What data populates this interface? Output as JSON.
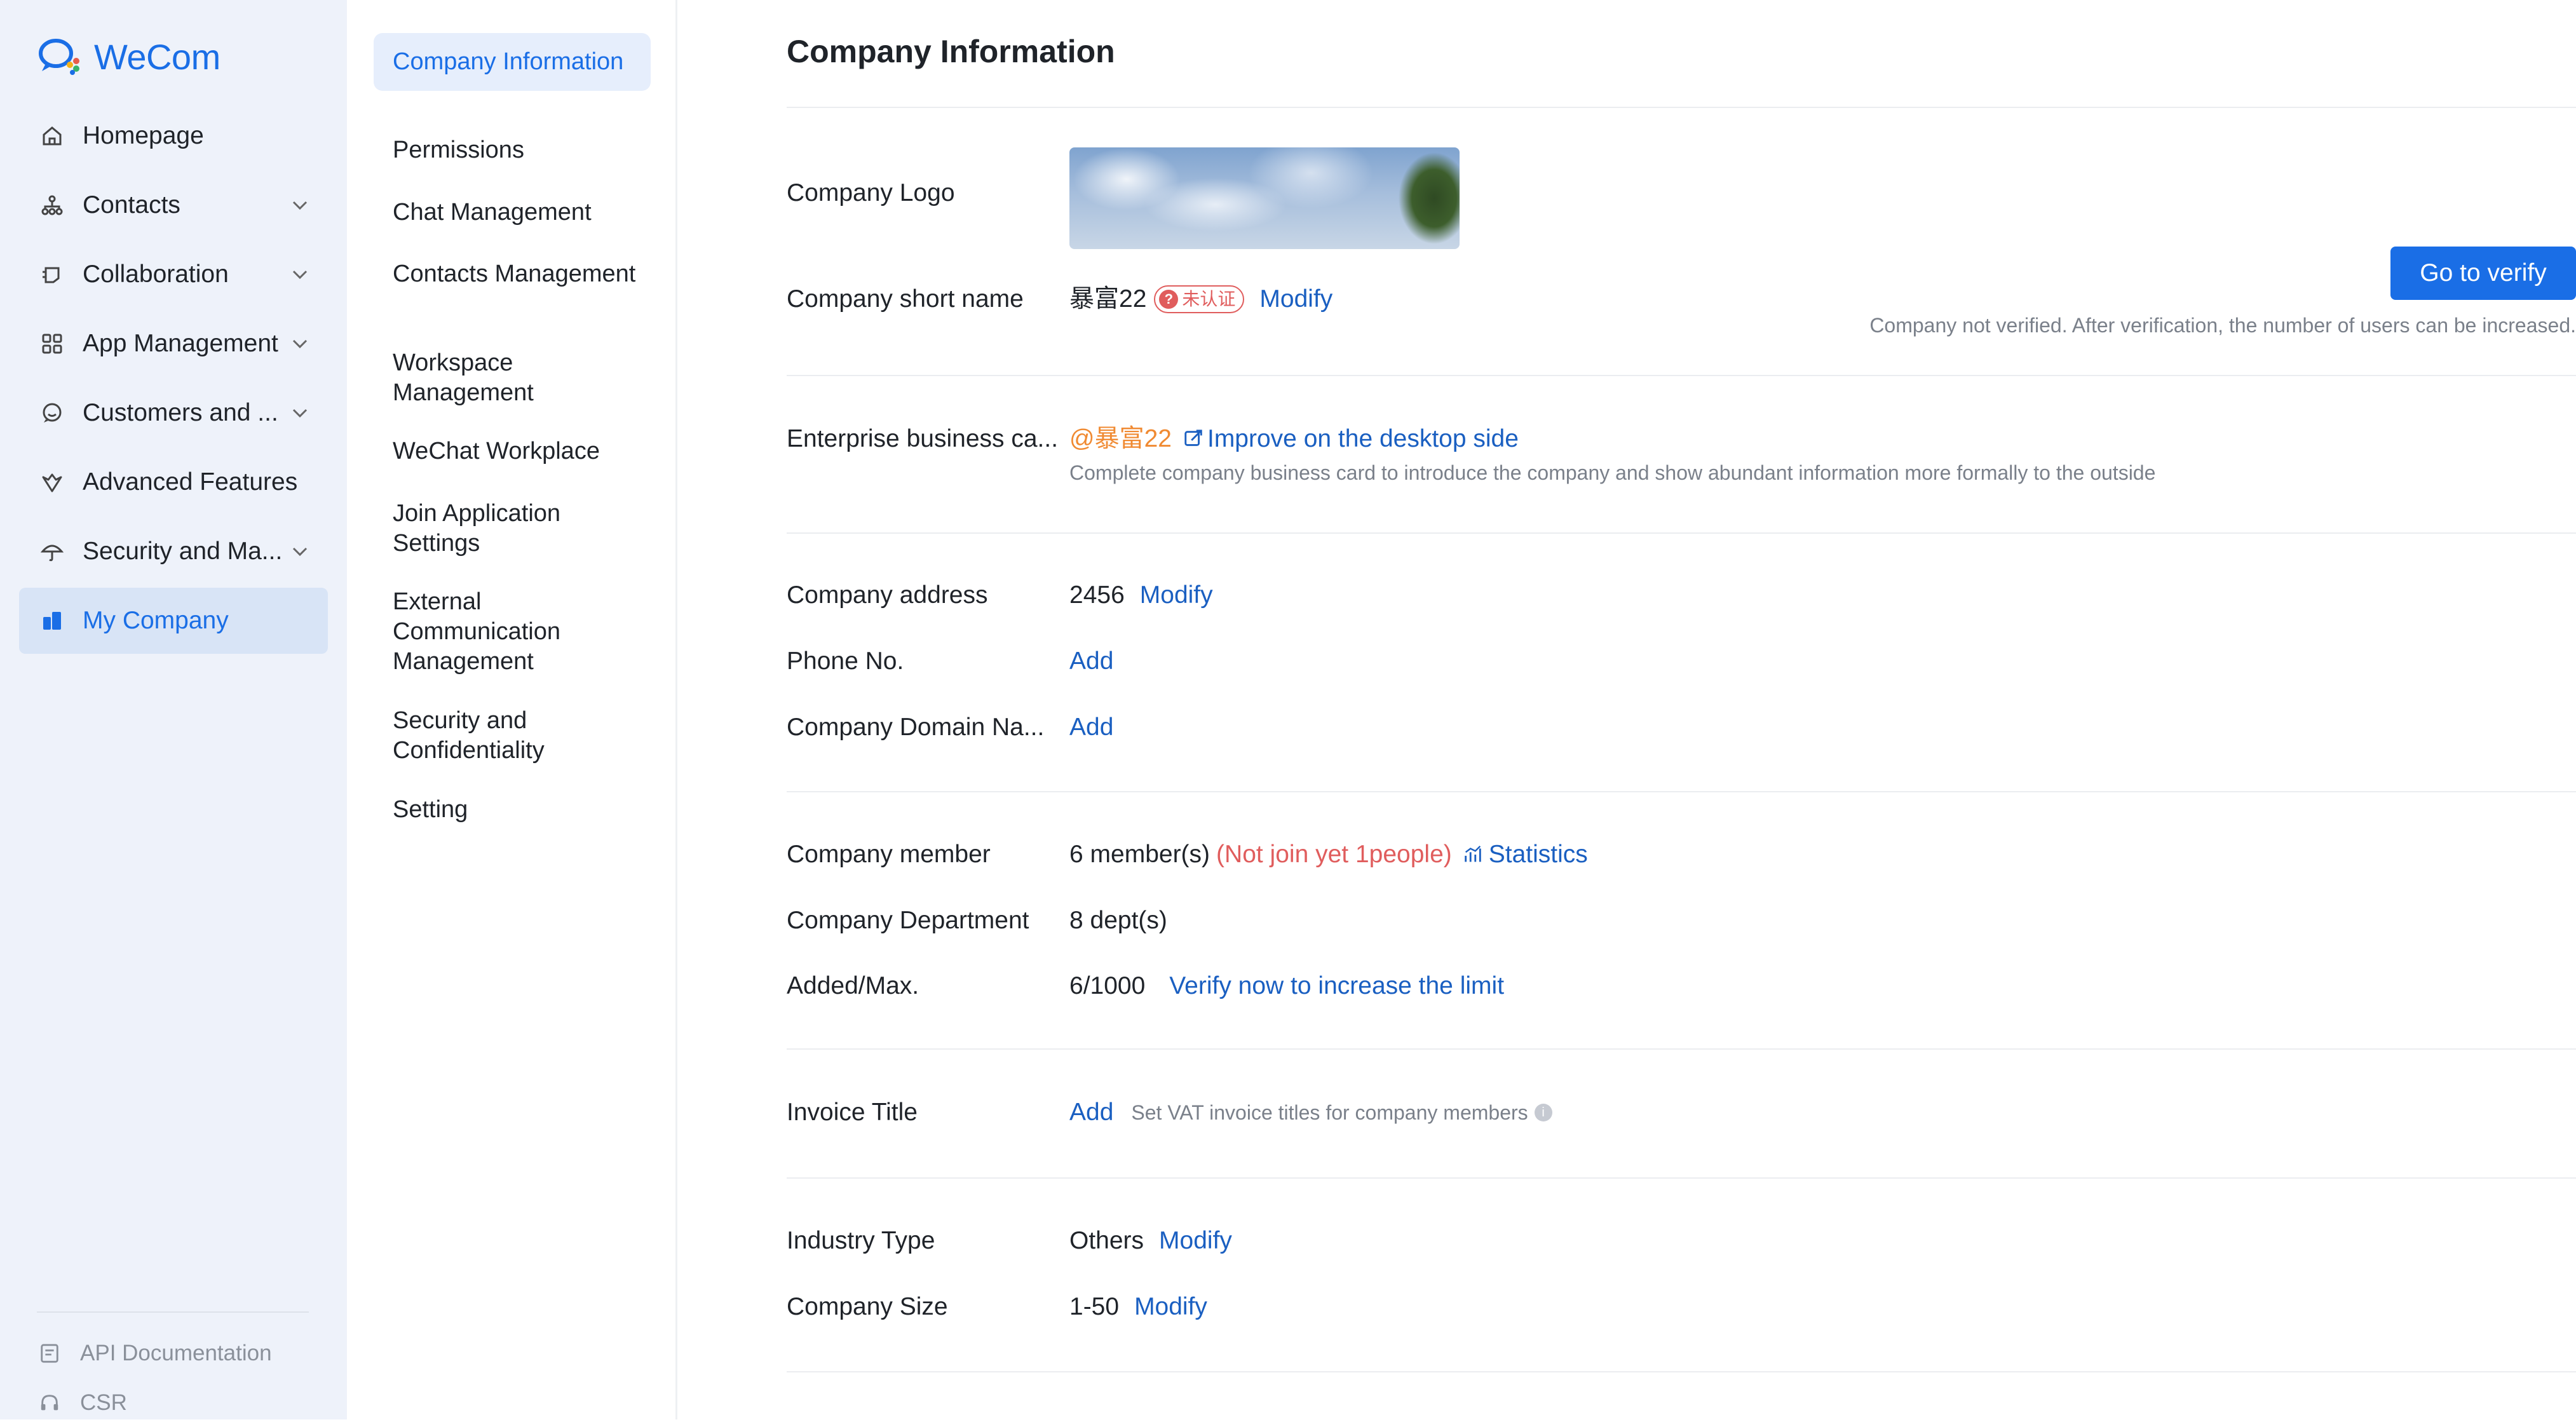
{
  "app": {
    "name": "WeCom"
  },
  "sidebar": {
    "items": [
      {
        "label": "Homepage",
        "icon": "home-icon"
      },
      {
        "label": "Contacts",
        "icon": "contacts-icon"
      },
      {
        "label": "Collaboration",
        "icon": "collaboration-icon"
      },
      {
        "label": "App Management",
        "icon": "apps-icon"
      },
      {
        "label": "Customers and ...",
        "icon": "customers-icon"
      },
      {
        "label": "Advanced Features",
        "icon": "advanced-features-icon"
      },
      {
        "label": "Security and Ma...",
        "icon": "umbrella-icon"
      },
      {
        "label": "My Company",
        "icon": "company-icon"
      }
    ],
    "bottom": [
      {
        "label": "API Documentation",
        "icon": "api-doc-icon"
      },
      {
        "label": "CSR",
        "icon": "headset-icon"
      }
    ]
  },
  "submenu": {
    "items": [
      {
        "label": "Company Information"
      },
      {
        "label": "Permissions"
      },
      {
        "label": "Chat Management"
      },
      {
        "label": "Contacts Management"
      },
      {
        "label": "Workspace Management"
      },
      {
        "label": "WeChat Workplace"
      },
      {
        "label": "Join Application Settings"
      },
      {
        "label": "External Communication Management"
      },
      {
        "label": "Security and Confidentiality"
      },
      {
        "label": "Setting"
      }
    ]
  },
  "main": {
    "title": "Company Information",
    "logo_label": "Company Logo",
    "short_name": {
      "label": "Company short name",
      "value": "暴富22",
      "badge": "未认证",
      "modify": "Modify"
    },
    "verify": {
      "button": "Go to verify",
      "note": "Company not verified. After verification, the number of users can be increased."
    },
    "business_card": {
      "label": "Enterprise business ca...",
      "value": "@暴富22",
      "link": "Improve on the desktop side",
      "hint": "Complete company business card to introduce the company and show abundant information more formally to the outside"
    },
    "address": {
      "label": "Company address",
      "value": "2456",
      "modify": "Modify"
    },
    "phone": {
      "label": "Phone No.",
      "add": "Add"
    },
    "domain": {
      "label": "Company Domain Na...",
      "add": "Add"
    },
    "member": {
      "label": "Company member",
      "value": "6 member(s)",
      "not_joined": "(Not join yet 1people)",
      "stats": "Statistics"
    },
    "department": {
      "label": "Company Department",
      "value": "8 dept(s)"
    },
    "added_max": {
      "label": "Added/Max.",
      "value": "6/1000",
      "link": "Verify now to increase the limit"
    },
    "invoice": {
      "label": "Invoice Title",
      "add": "Add",
      "hint": "Set VAT invoice titles for company members"
    },
    "industry": {
      "label": "Industry Type",
      "value": "Others",
      "modify": "Modify"
    },
    "size": {
      "label": "Company Size",
      "value": "1-50",
      "modify": "Modify"
    }
  },
  "colors": {
    "accent": "#1a6ee6",
    "link": "#1a5fc1",
    "danger": "#e05d5d",
    "warning": "#f08a32",
    "sidebar_bg": "#eef2fa"
  }
}
